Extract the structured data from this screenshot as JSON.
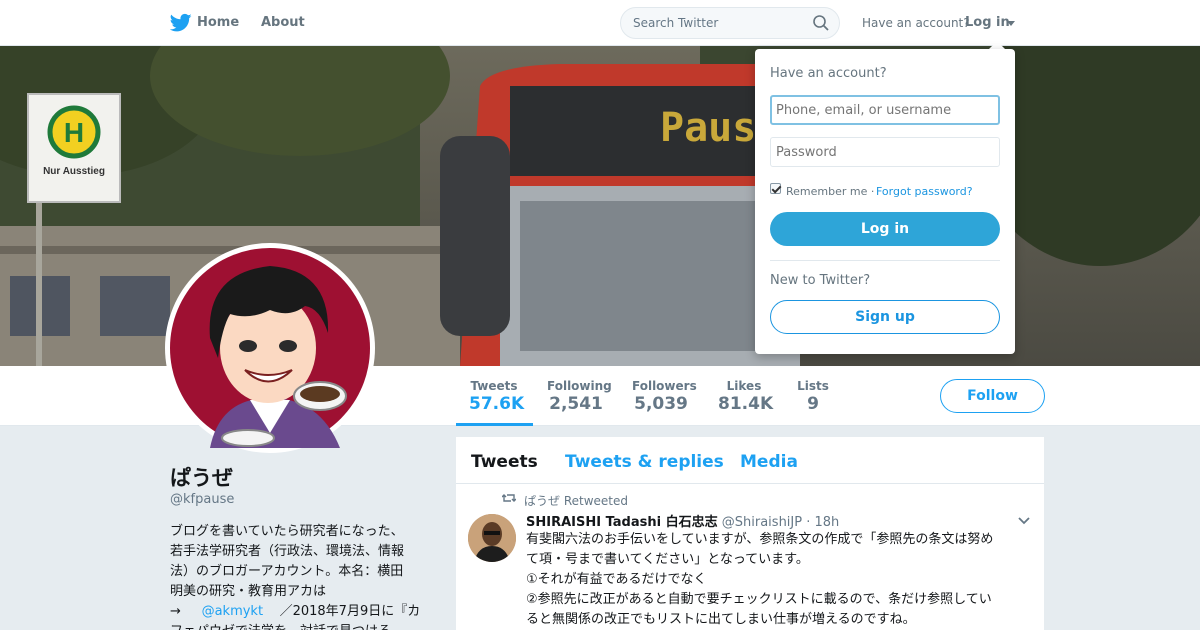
{
  "nav": {
    "home_label": "Home",
    "about_label": "About",
    "search_placeholder": "Search Twitter",
    "have_account": "Have an account?",
    "login_label": "Log in"
  },
  "banner": {
    "bus_sign": "Paus",
    "stop_sign_letter": "H",
    "stop_sign_caption": "Nur Ausstieg"
  },
  "profile": {
    "name": "ぱうぜ",
    "handle": "@kfpause",
    "bio_lines": [
      "ブログを書いていたら研究者になった、",
      "若手法学研究者（行政法、環境法、情報",
      "法）のブロガーアカウント。本名：横田",
      "明美の研究・教育用アカは"
    ],
    "bio_arrow": "→",
    "bio_mention": "@akmykt",
    "bio_tail": "／2018年7月9日に『カ",
    "bio_last": "フェパウゼで法学を　対話で見つける"
  },
  "stats": [
    {
      "label": "Tweets",
      "value": "57.6K"
    },
    {
      "label": "Following",
      "value": "2,541"
    },
    {
      "label": "Followers",
      "value": "5,039"
    },
    {
      "label": "Likes",
      "value": "81.4K"
    },
    {
      "label": "Lists",
      "value": "9"
    }
  ],
  "follow_label": "Follow",
  "timeline": {
    "tabs": [
      "Tweets",
      "Tweets & replies",
      "Media"
    ],
    "retweeted_by": "ぱうぜ Retweeted",
    "tweet": {
      "author": "SHIRAISHI Tadashi 白石忠志",
      "handle": "@ShiraishiJP",
      "time": "· 18h",
      "lines": [
        "有斐閣六法のお手伝いをしていますが、参照条文の作成で「参照先の条文は努め",
        "て項・号まで書いてください」となっています。",
        "①それが有益であるだけでなく",
        "②参照先に改正があると自動で要チェックリストに載るので、条だけ参照してい",
        "ると無関係の改正でもリストに出てしまい仕事が増えるのですね。"
      ]
    }
  },
  "login_dropdown": {
    "title": "Have an account?",
    "username_placeholder": "Phone, email, or username",
    "password_placeholder": "Password",
    "remember_label": "Remember me · ",
    "forgot_label": "Forgot password?",
    "login_button": "Log in",
    "new_label": "New to Twitter?",
    "signup_button": "Sign up"
  },
  "colors": {
    "accent": "#1da1f2",
    "avatar_background": "#9e1032"
  },
  "icons": [
    "twitter-bird-icon",
    "search-icon",
    "chevron-down-icon",
    "retweet-icon"
  ]
}
